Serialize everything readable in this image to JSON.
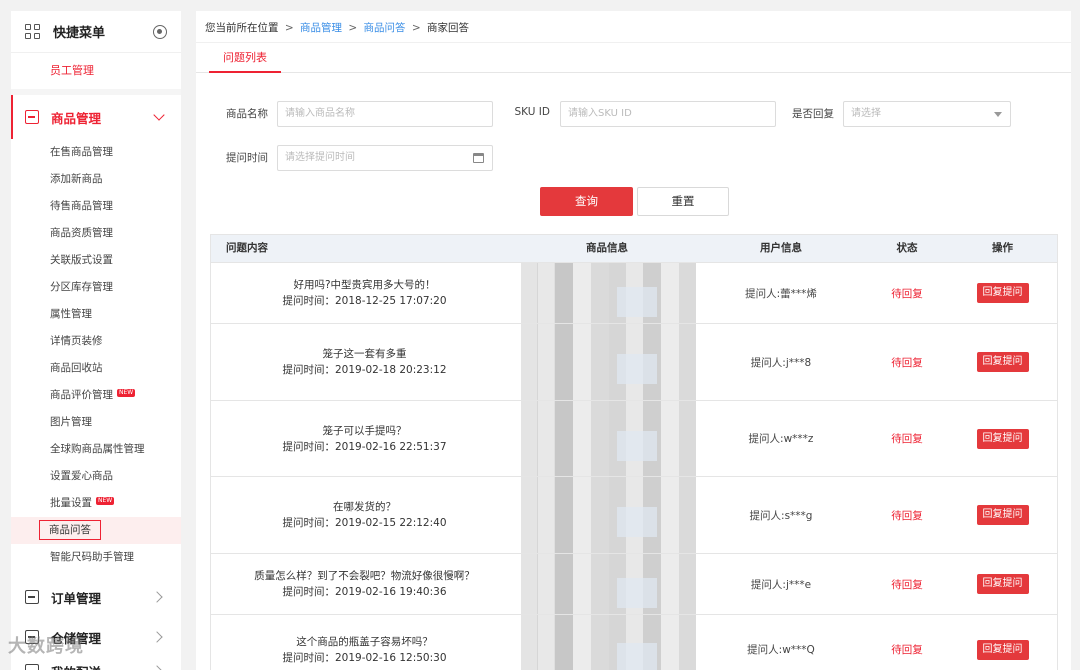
{
  "sidebar": {
    "quick_title": "快捷菜单",
    "quick_item": "员工管理",
    "goods": {
      "title": "商品管理",
      "items": [
        {
          "label": "在售商品管理",
          "new": false
        },
        {
          "label": "添加新商品",
          "new": false
        },
        {
          "label": "待售商品管理",
          "new": false
        },
        {
          "label": "商品资质管理",
          "new": false
        },
        {
          "label": "关联版式设置",
          "new": false
        },
        {
          "label": "分区库存管理",
          "new": false
        },
        {
          "label": "属性管理",
          "new": false
        },
        {
          "label": "详情页装修",
          "new": false
        },
        {
          "label": "商品回收站",
          "new": false
        },
        {
          "label": "商品评价管理",
          "new": true
        },
        {
          "label": "图片管理",
          "new": false
        },
        {
          "label": "全球购商品属性管理",
          "new": false
        },
        {
          "label": "设置爱心商品",
          "new": false
        },
        {
          "label": "批量设置",
          "new": true
        },
        {
          "label": "商品问答",
          "new": false,
          "selected": true
        },
        {
          "label": "智能尺码助手管理",
          "new": false
        }
      ]
    },
    "order_title": "订单管理",
    "warehouse_title": "仓储管理",
    "delivery_title": "我的配送",
    "new_badge": "NEW"
  },
  "breadcrumb": {
    "prefix": "您当前所在位置",
    "level1": "商品管理",
    "level2": "商品问答",
    "current": "商家回答",
    "sep": ">"
  },
  "tab": {
    "label": "问题列表"
  },
  "filters": {
    "name_label": "商品名称",
    "name_placeholder": "请输入商品名称",
    "sku_label": "SKU ID",
    "sku_placeholder": "请输入SKU ID",
    "reply_label": "是否回复",
    "reply_placeholder": "请选择",
    "time_label": "提问时间",
    "time_placeholder": "请选择提问时间",
    "query_button": "查询",
    "reset_button": "重置"
  },
  "table": {
    "headers": [
      "问题内容",
      "商品信息",
      "用户信息",
      "状态",
      "操作"
    ],
    "rows": [
      {
        "question": "好用吗?中型贵宾用多大号的！",
        "time": "提问时间：2018-12-25 17:07:20",
        "user": "提问人:蕾***烯",
        "status": "待回复",
        "action": "回复提问"
      },
      {
        "question": "笼子这一套有多重",
        "time": "提问时间：2019-02-18 20:23:12",
        "user": "提问人:j***8",
        "status": "待回复",
        "action": "回复提问"
      },
      {
        "question": "笼子可以手提吗？",
        "time": "提问时间：2019-02-16 22:51:37",
        "user": "提问人:w***z",
        "status": "待回复",
        "action": "回复提问"
      },
      {
        "question": "在哪发货的？",
        "time": "提问时间：2019-02-15 22:12:40",
        "user": "提问人:s***g",
        "status": "待回复",
        "action": "回复提问"
      },
      {
        "question": "质量怎么样？到了不会裂吧？物流好像很慢啊？",
        "time": "提问时间：2019-02-16 19:40:36",
        "user": "提问人:j***e",
        "status": "待回复",
        "action": "回复提问"
      },
      {
        "question": "这个商品的瓶盖子容易坏吗？",
        "time": "提问时间：2019-02-16 12:50:30",
        "user": "提问人:w***Q",
        "status": "待回复",
        "action": "回复提问"
      }
    ]
  },
  "watermark": "大数跨境",
  "colors": {
    "accent": "#e4393c",
    "link": "#3a8ee6",
    "header_bg": "#eef2f7"
  }
}
